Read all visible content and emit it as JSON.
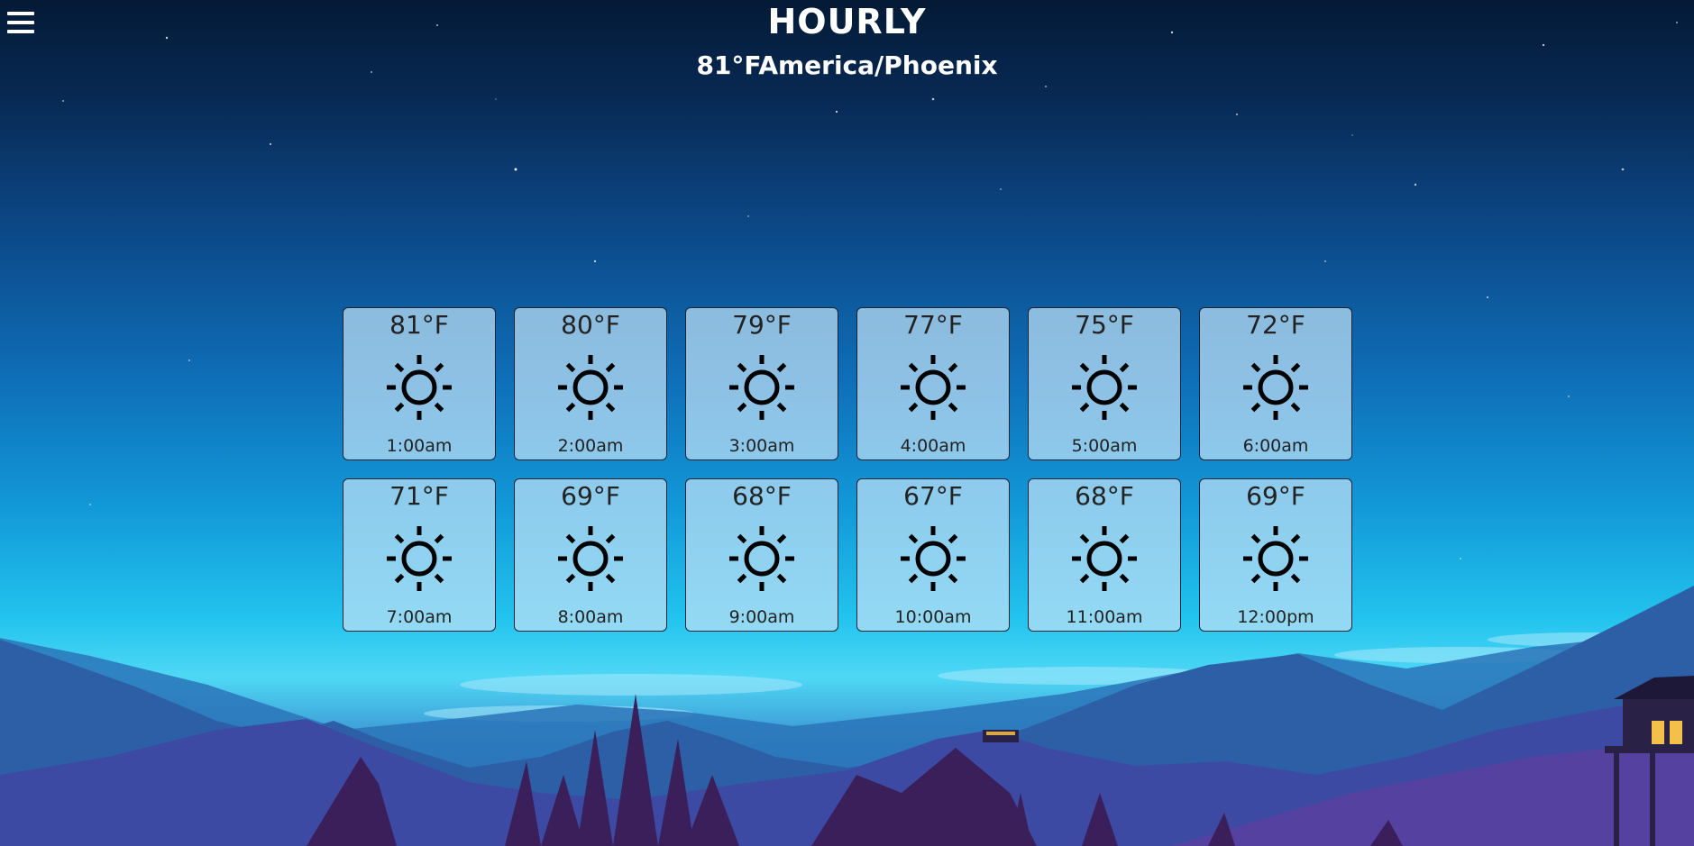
{
  "header": {
    "title": "HOURLY",
    "subtitle": "81°FAmerica/Phoenix",
    "menu_icon": "hamburger-menu-icon"
  },
  "hourly": [
    {
      "temp": "81°F",
      "time": "1:00am",
      "icon": "sun-icon"
    },
    {
      "temp": "80°F",
      "time": "2:00am",
      "icon": "sun-icon"
    },
    {
      "temp": "79°F",
      "time": "3:00am",
      "icon": "sun-icon"
    },
    {
      "temp": "77°F",
      "time": "4:00am",
      "icon": "sun-icon"
    },
    {
      "temp": "75°F",
      "time": "5:00am",
      "icon": "sun-icon"
    },
    {
      "temp": "72°F",
      "time": "6:00am",
      "icon": "sun-icon"
    },
    {
      "temp": "71°F",
      "time": "7:00am",
      "icon": "sun-icon"
    },
    {
      "temp": "69°F",
      "time": "8:00am",
      "icon": "sun-icon"
    },
    {
      "temp": "68°F",
      "time": "9:00am",
      "icon": "sun-icon"
    },
    {
      "temp": "67°F",
      "time": "10:00am",
      "icon": "sun-icon"
    },
    {
      "temp": "68°F",
      "time": "11:00am",
      "icon": "sun-icon"
    },
    {
      "temp": "69°F",
      "time": "12:00pm",
      "icon": "sun-icon"
    }
  ],
  "colors": {
    "card_background": "#bee1f5",
    "card_border": "#1a2233",
    "header_text": "#ffffff"
  }
}
